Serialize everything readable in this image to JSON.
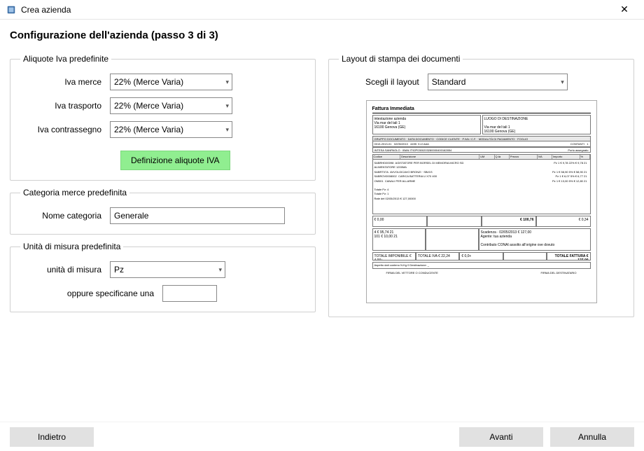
{
  "window": {
    "title": "Crea azienda",
    "close_label": "✕"
  },
  "header": {
    "title": "Configurazione dell'azienda (passo 3 di 3)"
  },
  "vat_section": {
    "legend": "Aliquote Iva predefinite",
    "merce_label": "Iva merce",
    "merce_value": "22% (Merce Varia)",
    "trasporto_label": "Iva trasporto",
    "trasporto_value": "22% (Merce Varia)",
    "contrassegno_label": "Iva contrassegno",
    "contrassegno_value": "22% (Merce Varia)",
    "def_button": "Definizione aliquote IVA"
  },
  "cat_section": {
    "legend": "Categoria merce predefinita",
    "name_label": "Nome categoria",
    "name_value": "Generale"
  },
  "unit_section": {
    "legend": "Unità di misura predefinita",
    "unit_label": "unità di misura",
    "unit_value": "Pz",
    "spec_label": "oppure specificane una",
    "spec_value": ""
  },
  "layout_section": {
    "legend": "Layout di stampa dei documenti",
    "select_label": "Scegli il layout",
    "select_value": "Standard",
    "preview": {
      "doc_title": "Fattura Immediata",
      "sender": "intestazione azienda\nVia mar del tali 1\n16100 Genova (GE)",
      "recipient": "LUOGO DI DESTINAZIONE\n\nVia mar del tali 1\n16100 Genova (GE)",
      "docrow": {
        "grp": "GRUPPO DOCUMENTO",
        "grp_v": "0013-2013-01",
        "date": "DATA DOCUMENTO",
        "date_v": "02/05/2013",
        "cod": "CODICE CLIENTE",
        "cod_v": "4495",
        "piva": "P.IVA / C.F.",
        "piva_v": "KJJ  AAA",
        "pag": "MODALITÀ DI PAGAMENTO",
        "pag_v": "CONTANTI",
        "page": "FOGLIO",
        "page_v": "1"
      },
      "bank": "INTESA SANPAOLO · IBAN IT92P0300203280000400162854",
      "bank_right": "Porto assegnato",
      "items": [
        {
          "code": "SABRHD00098",
          "desc": "AGISTATORE PER BORSEL DI MEMORIA MICRO SD",
          "um": "Pz",
          "q": "1",
          "price": "€ 9,78",
          "iva": "22%",
          "tot": "€ 9,78",
          "pr": "21"
        },
        {
          "code": "",
          "desc": "ALIMENTATORE 1200MA",
          "um": "",
          "q": "",
          "price": "",
          "iva": "",
          "tot": "",
          "pr": ""
        },
        {
          "code": "SABRT07A",
          "desc": "AVVOLGICAVO BRONZI · SBI/1S",
          "um": "Pz",
          "q": "1",
          "price": "€ 58,90",
          "iva": "5%",
          "tot": "€ 58,90",
          "pr": "21"
        },
        {
          "code": "SABROV0008002",
          "desc": "CARICA BATTERIA U X70 400",
          "um": "Pz",
          "q": "1",
          "price": "€ 6,07",
          "iva": "5%",
          "tot": "€ 6,77",
          "pr": "21"
        },
        {
          "code": "OM001",
          "desc": "CANALI PER ALLARME",
          "um": "Pz",
          "q": "1",
          "price": "€ 13,00",
          "iva": "5%",
          "tot": "€ 12,80",
          "pr": "21"
        }
      ],
      "summary1": "Totale Pz: 4",
      "summary2": "Totale Pz: 1",
      "summary3": "Rate del 02/05/2013 € 127,00000",
      "tot_weight": "€ 0,00",
      "tot_volume": "",
      "tot_imponibile": "€ 100,76",
      "tot_iva": "€ 0,34",
      "bottom_rates": "4  € 95,74  21\n101  € 10,00  21",
      "bottom_note": "Scadenza · 02/05/2013 € 127,00\nAgente: tua azienda\n\nContributo CONAI assolto all'origine ove dovuto",
      "final_imp": "TOTALE IMPONIBILE  € 4,00+",
      "final_iva": "TOTALE IVA  € 22,24",
      "final_sp": "€ 0,0+",
      "final_arr": "",
      "final_tot": "TOTALE FATTURA  € 127,00",
      "dest": "Aspetto dati conteno                                        N.Kg 0                  Destinazione: _",
      "sig_left": "FIRMA DEL VETTORE O CONDUCENTE",
      "sig_right": "FIRMA DEL DESTINATARIO"
    }
  },
  "footer": {
    "back": "Indietro",
    "next": "Avanti",
    "cancel": "Annulla"
  }
}
